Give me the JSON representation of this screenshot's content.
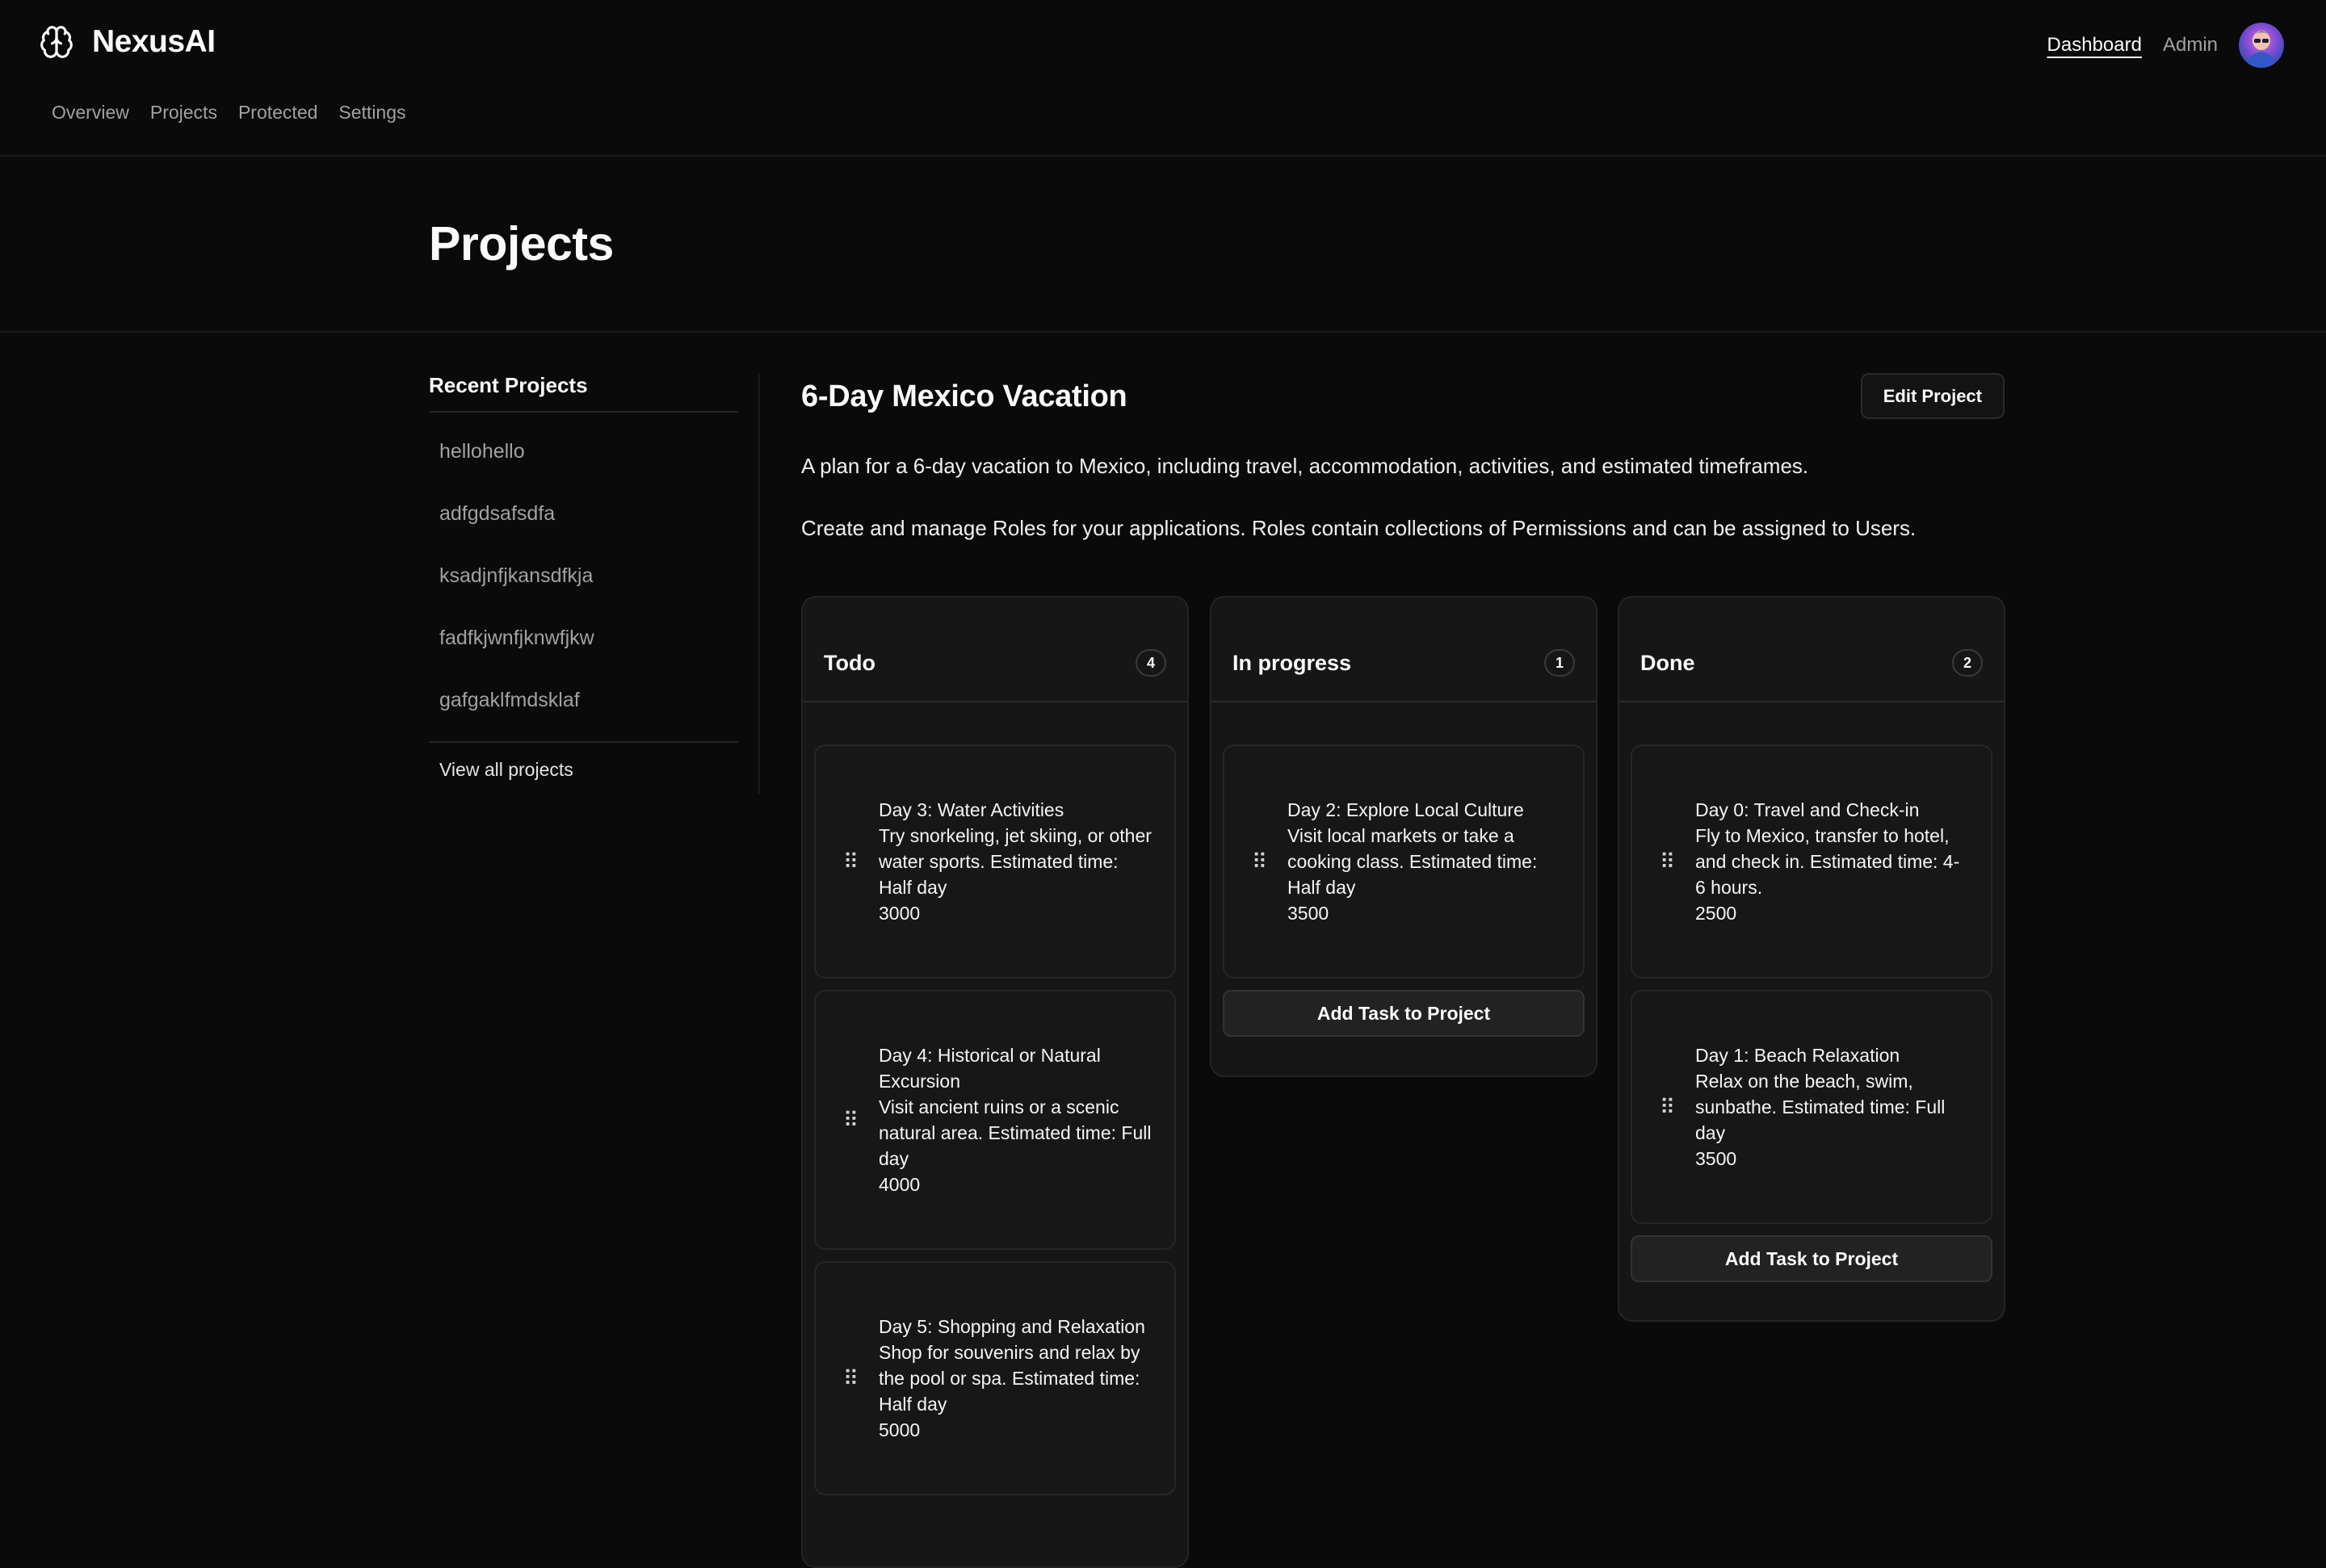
{
  "app": {
    "name": "NexusAI"
  },
  "nav": [
    "Overview",
    "Projects",
    "Protected",
    "Settings"
  ],
  "top_links": {
    "dashboard": "Dashboard",
    "admin": "Admin"
  },
  "page": {
    "title": "Projects"
  },
  "sidebar": {
    "heading": "Recent Projects",
    "items": [
      "hellohello",
      "adfgdsafsdfa",
      "ksadjnfjkansdfkja",
      "fadfkjwnfjknwfjkw",
      "gafgaklfmdsklaf"
    ],
    "view_all": "View all projects"
  },
  "project": {
    "title": "6-Day Mexico Vacation",
    "edit_label": "Edit Project",
    "description": "A plan for a 6-day vacation to Mexico, including travel, accommodation, activities, and estimated timeframes.",
    "subtext": "Create and manage Roles for your applications. Roles contain collections of Permissions and can be assigned to Users."
  },
  "add_task_label": "Add Task to Project",
  "columns": [
    {
      "title": "Todo",
      "count": "4",
      "tasks": [
        {
          "title": "Day 3: Water Activities",
          "desc": "Try snorkeling, jet skiing, or other water sports. Estimated time: Half day",
          "value": "3000"
        },
        {
          "title": "Day 4: Historical or Natural Excursion",
          "desc": "Visit ancient ruins or a scenic natural area. Estimated time: Full day",
          "value": "4000"
        },
        {
          "title": "Day 5: Shopping and Relaxation",
          "desc": "Shop for souvenirs and relax by the pool or spa. Estimated time: Half day",
          "value": "5000"
        }
      ]
    },
    {
      "title": "In progress",
      "count": "1",
      "tasks": [
        {
          "title": "Day 2: Explore Local Culture",
          "desc": "Visit local markets or take a cooking class. Estimated time: Half day",
          "value": "3500"
        }
      ]
    },
    {
      "title": "Done",
      "count": "2",
      "tasks": [
        {
          "title": "Day 0: Travel and Check-in",
          "desc": "Fly to Mexico, transfer to hotel, and check in. Estimated time: 4-6 hours.",
          "value": "2500"
        },
        {
          "title": "Day 1: Beach Relaxation",
          "desc": "Relax on the beach, swim, sunbathe. Estimated time: Full day",
          "value": "3500"
        }
      ]
    }
  ],
  "icons": {
    "brand": "brain-icon",
    "grip": "drag-handle-icon",
    "avatar": "user-avatar"
  }
}
